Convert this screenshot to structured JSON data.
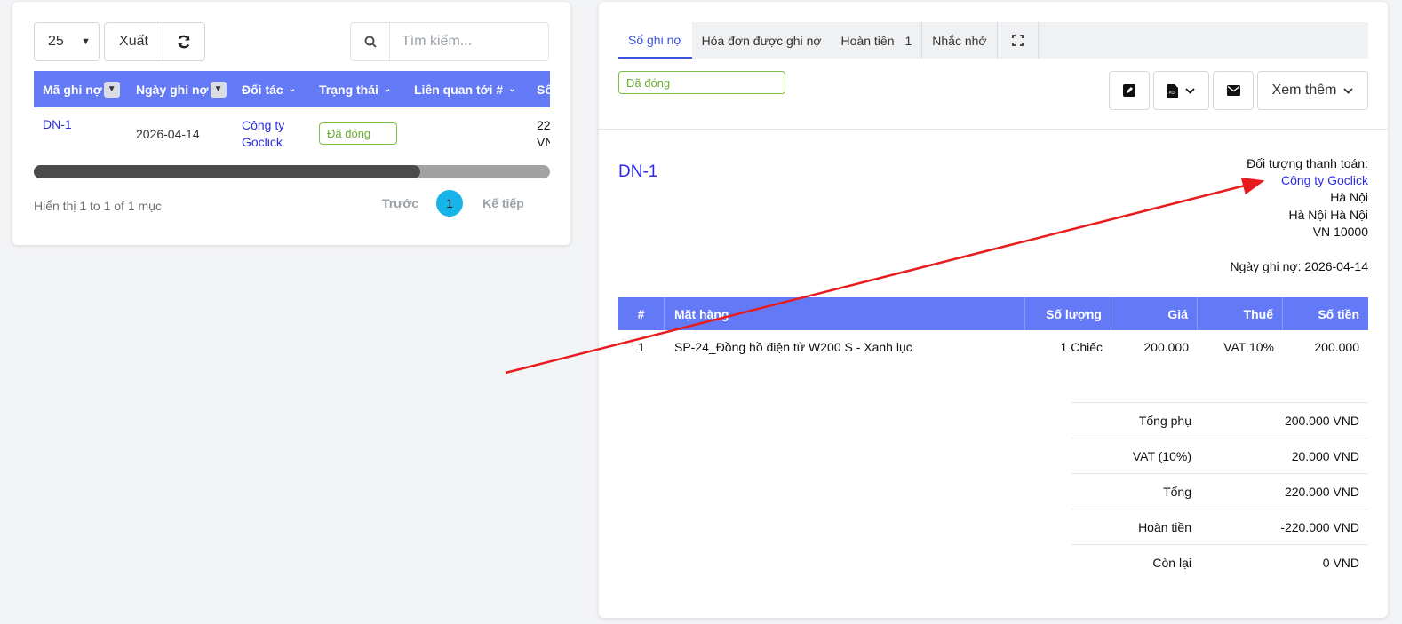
{
  "list": {
    "page_size": "25",
    "export_label": "Xuất",
    "search_placeholder": "Tìm kiếm...",
    "columns": [
      "Mã ghi nợ",
      "Ngày ghi nợ",
      "Đối tác",
      "Trạng thái",
      "Liên quan tới #",
      "Số"
    ],
    "rows": [
      {
        "code": "DN-1",
        "date": "2026-04-14",
        "partner_line1": "Công ty",
        "partner_line2": "Goclick",
        "status": "Đã đóng",
        "related": "",
        "amount_line1": "22",
        "amount_line2": "VN"
      }
    ],
    "info": "Hiển thị 1 to 1 of 1 mục",
    "prev": "Trước",
    "page": "1",
    "next": "Kế tiếp"
  },
  "detail": {
    "tabs": [
      {
        "label": "Sổ ghi nợ"
      },
      {
        "label": "Hóa đơn được ghi nợ"
      },
      {
        "label": "Hoàn tiền",
        "count": "1"
      },
      {
        "label": "Nhắc nhở"
      }
    ],
    "status": "Đã đóng",
    "more_label": "Xem thêm",
    "doc_id": "DN-1",
    "bill_to_label": "Đối tượng thanh toán:",
    "bill_to_name": "Công ty Goclick",
    "bill_to_city": "Hà Nội",
    "bill_to_state": "Hà Nội Hà Nội",
    "bill_to_zip": "VN 10000",
    "date_label": "Ngày ghi nợ:",
    "date_value": "2026-04-14",
    "item_columns": {
      "num": "#",
      "item": "Mặt hàng",
      "qty": "Số lượng",
      "price": "Giá",
      "tax": "Thuế",
      "amount": "Số tiền"
    },
    "items": [
      {
        "num": "1",
        "item": "SP-24_Đồng hồ điện tử W200 S - Xanh lục",
        "qty": "1 Chiếc",
        "price": "200.000",
        "tax": "VAT 10%",
        "amount": "200.000"
      }
    ],
    "totals": [
      {
        "label": "Tổng phụ",
        "value": "200.000 VND"
      },
      {
        "label": "VAT (10%)",
        "value": "20.000 VND"
      },
      {
        "label": "Tổng",
        "value": "220.000 VND"
      },
      {
        "label": "Hoàn tiền",
        "value": "-220.000 VND"
      },
      {
        "label": "Còn lại",
        "value": "0 VND"
      }
    ]
  },
  "colors": {
    "header_blue": "#6379f5",
    "link": "#2c2ce6",
    "status_green": "#6aad33",
    "page_active": "#17b4e9",
    "annotation_arrow": "#e81c1c"
  }
}
